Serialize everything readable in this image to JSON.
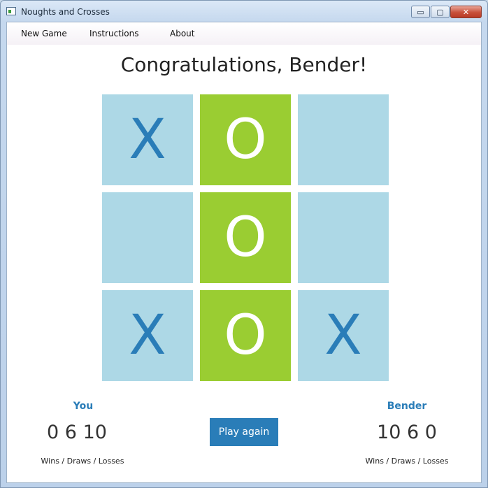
{
  "window": {
    "title": "Noughts and Crosses",
    "controls": {
      "minimize": "▭",
      "maximize": "▢",
      "close": "✕"
    }
  },
  "menu": {
    "items": [
      "New Game",
      "Instructions",
      "About"
    ]
  },
  "headline": "Congratulations, Bender!",
  "board": {
    "cells": [
      "X",
      "O",
      "",
      "",
      "O",
      "",
      "X",
      "O",
      "X"
    ],
    "winning_cells": [
      1,
      4,
      7
    ],
    "colors": {
      "normal": "#add8e6",
      "winning": "#9acd32",
      "x_mark": "#2a7db8",
      "o_mark_on_win": "#ffffff"
    }
  },
  "players": {
    "you": {
      "name": "You",
      "score": "0 6 10",
      "label": "Wins / Draws / Losses"
    },
    "opponent": {
      "name": "Bender",
      "score": "10 6 0",
      "label": "Wins / Draws / Losses"
    }
  },
  "play_again": {
    "label": "Play again"
  },
  "colors": {
    "accent": "#2a7db8"
  }
}
